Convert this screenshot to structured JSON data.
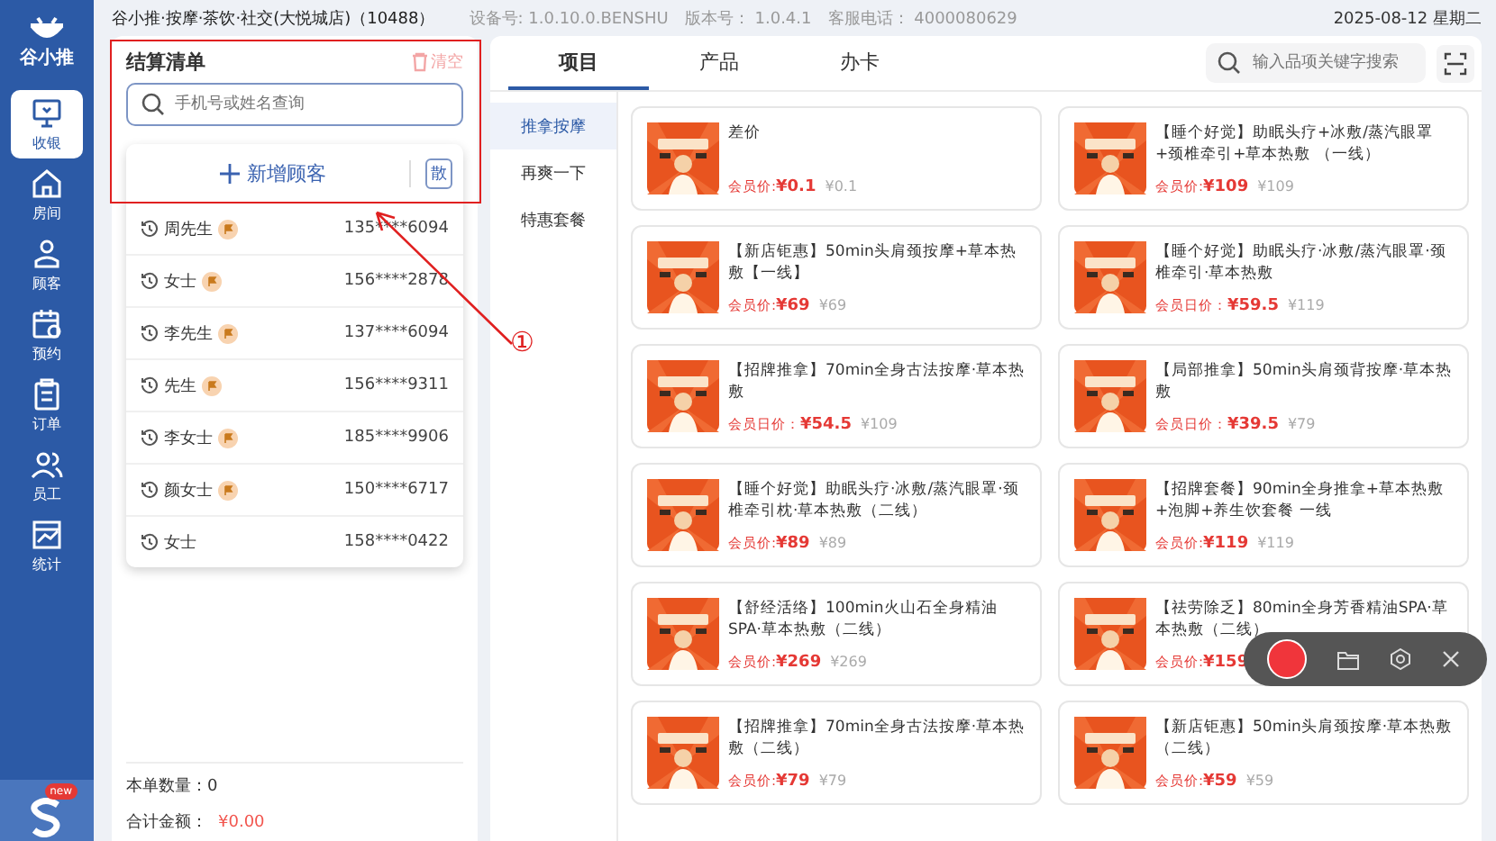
{
  "sidebar": {
    "logo": "谷小推",
    "items": [
      {
        "label": "收银",
        "selected": true
      },
      {
        "label": "房间",
        "selected": false
      },
      {
        "label": "顾客",
        "selected": false
      },
      {
        "label": "预约",
        "selected": false
      },
      {
        "label": "订单",
        "selected": false
      },
      {
        "label": "员工",
        "selected": false
      },
      {
        "label": "统计",
        "selected": false
      }
    ],
    "app_badge": "new"
  },
  "top_bar": {
    "store": "谷小推·按摩·茶饮·社交(大悦城店)（10488）",
    "device": "设备号: 1.0.10.0.BENSHU",
    "version": "版本号： 1.0.4.1",
    "hotline": "客服电话： 4000080629",
    "date": "2025-08-12 星期二"
  },
  "checkout": {
    "title": "结算清单",
    "clear": "清空",
    "search": {
      "placeholder": "手机号或姓名查询"
    },
    "add_customer": "新增顾客",
    "walk_in": "散",
    "customers": [
      {
        "name": "周先生",
        "vip": true,
        "phone": "135****6094"
      },
      {
        "name": "女士",
        "vip": true,
        "phone": "156****2878"
      },
      {
        "name": "李先生",
        "vip": true,
        "phone": "137****6094"
      },
      {
        "name": "先生",
        "vip": true,
        "phone": "156****9311"
      },
      {
        "name": "李女士",
        "vip": true,
        "phone": "185****9906"
      },
      {
        "name": "颜女士",
        "vip": true,
        "phone": "150****6717"
      },
      {
        "name": "女士",
        "vip": false,
        "phone": "158****0422"
      }
    ],
    "count_label": "本单数量：",
    "count": "0",
    "total_label": "合计金额：",
    "total": "¥0.00"
  },
  "tabs": [
    {
      "label": "项目",
      "selected": true
    },
    {
      "label": "产品",
      "selected": false
    },
    {
      "label": "办卡",
      "selected": false
    }
  ],
  "item_search": {
    "placeholder": "输入品项关键字搜索"
  },
  "categories": [
    {
      "label": "推拿按摩",
      "selected": true
    },
    {
      "label": "再爽一下",
      "selected": false
    },
    {
      "label": "特惠套餐",
      "selected": false
    }
  ],
  "items": [
    {
      "name": "差价",
      "price_label": "会员价:",
      "price": "¥0.1",
      "original": "¥0.1"
    },
    {
      "name": "【睡个好觉】助眠头疗+冰敷/蒸汽眼罩+颈椎牵引+草本热敷 （一线）",
      "price_label": "会员价:",
      "price": "¥109",
      "original": "¥109"
    },
    {
      "name": "【新店钜惠】50min头肩颈按摩+草本热敷【一线】",
      "price_label": "会员价:",
      "price": "¥69",
      "original": "¥69"
    },
    {
      "name": "【睡个好觉】助眠头疗·冰敷/蒸汽眼罩·颈椎牵引·草本热敷",
      "price_label": "会员日价：",
      "price": "¥59.5",
      "original": "¥119"
    },
    {
      "name": "【招牌推拿】70min全身古法按摩·草本热敷",
      "price_label": "会员日价：",
      "price": "¥54.5",
      "original": "¥109"
    },
    {
      "name": "【局部推拿】50min头肩颈背按摩·草本热敷",
      "price_label": "会员日价：",
      "price": "¥39.5",
      "original": "¥79"
    },
    {
      "name": "【睡个好觉】助眠头疗·冰敷/蒸汽眼罩·颈椎牵引枕·草本热敷（二线）",
      "price_label": "会员价:",
      "price": "¥89",
      "original": "¥89"
    },
    {
      "name": "【招牌套餐】90min全身推拿+草本热敷+泡脚+养生饮套餐 一线",
      "price_label": "会员价:",
      "price": "¥119",
      "original": "¥119"
    },
    {
      "name": "【舒经活络】100min火山石全身精油SPA·草本热敷（二线）",
      "price_label": "会员价:",
      "price": "¥269",
      "original": "¥269"
    },
    {
      "name": "【祛劳除乏】80min全身芳香精油SPA·草本热敷（二线）",
      "price_label": "会员价:",
      "price": "¥159"
    },
    {
      "name": "【招牌推拿】70min全身古法按摩·草本热敷（二线）",
      "price_label": "会员价:",
      "price": "¥79",
      "original": "¥79"
    },
    {
      "name": "【新店钜惠】50min头肩颈按摩·草本热敷（二线）",
      "price_label": "会员价:",
      "price": "¥59",
      "original": "¥59"
    }
  ],
  "annotation": {
    "marker": "①"
  }
}
